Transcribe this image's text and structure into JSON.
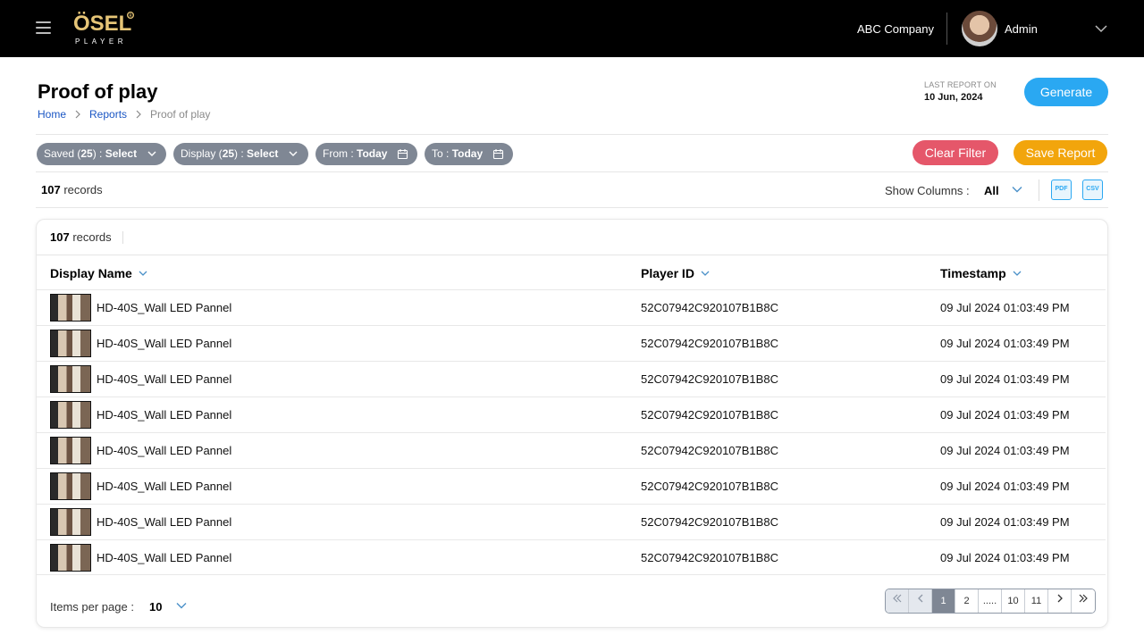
{
  "header": {
    "logo_main": "ÖSEL",
    "logo_sub": "PLAYER",
    "logo_reg": "®",
    "company": "ABC Company",
    "user": "Admin"
  },
  "page": {
    "title": "Proof of play",
    "breadcrumb": [
      "Home",
      "Reports",
      "Proof of play"
    ],
    "last_report_label": "LAST REPORT ON",
    "last_report_date": "10 Jun, 2024",
    "generate_label": "Generate"
  },
  "filters": {
    "saved_prefix": "Saved (",
    "saved_count": "25",
    "saved_suffix": ") : ",
    "saved_value": "Select",
    "display_prefix": "Display (",
    "display_count": "25",
    "display_suffix": ") : ",
    "display_value": "Select",
    "from_label": "From : ",
    "from_value": "Today",
    "to_label": "To : ",
    "to_value": "Today",
    "clear_label": "Clear Filter",
    "save_label": "Save Report"
  },
  "toolbar": {
    "records_count": "107",
    "records_label": " records",
    "show_columns_label": "Show Columns :",
    "show_columns_value": "All",
    "pdf_label": "PDF",
    "csv_label": "CSV"
  },
  "table": {
    "records_count": "107",
    "records_label": " records",
    "columns": [
      "Display Name",
      "Player ID",
      "Timestamp"
    ],
    "rows": [
      {
        "name": "HD-40S_Wall LED Pannel",
        "player_id": "52C07942C920107B1B8C",
        "timestamp": "09 Jul 2024 01:03:49 PM"
      },
      {
        "name": "HD-40S_Wall LED Pannel",
        "player_id": "52C07942C920107B1B8C",
        "timestamp": "09 Jul 2024 01:03:49 PM"
      },
      {
        "name": "HD-40S_Wall LED Pannel",
        "player_id": "52C07942C920107B1B8C",
        "timestamp": "09 Jul 2024 01:03:49 PM"
      },
      {
        "name": "HD-40S_Wall LED Pannel",
        "player_id": "52C07942C920107B1B8C",
        "timestamp": "09 Jul 2024 01:03:49 PM"
      },
      {
        "name": "HD-40S_Wall LED Pannel",
        "player_id": "52C07942C920107B1B8C",
        "timestamp": "09 Jul 2024 01:03:49 PM"
      },
      {
        "name": "HD-40S_Wall LED Pannel",
        "player_id": "52C07942C920107B1B8C",
        "timestamp": "09 Jul 2024 01:03:49 PM"
      },
      {
        "name": "HD-40S_Wall LED Pannel",
        "player_id": "52C07942C920107B1B8C",
        "timestamp": "09 Jul 2024 01:03:49 PM"
      },
      {
        "name": "HD-40S_Wall LED Pannel",
        "player_id": "52C07942C920107B1B8C",
        "timestamp": "09 Jul 2024 01:03:49 PM"
      }
    ]
  },
  "footer": {
    "items_per_page_label": "Items per page :",
    "items_per_page_value": "10",
    "pages": [
      "1",
      "2",
      ".....",
      "10",
      "11"
    ],
    "active_page": "1"
  },
  "colors": {
    "primary": "#2aa8f2",
    "danger": "#e5576a",
    "warning": "#f2a50c",
    "chip": "#7f8794",
    "logo_gold": "#e6c577"
  },
  "icons": [
    "menu-icon",
    "chevron-down-icon",
    "calendar-icon",
    "chevron-right-icon",
    "first-page-icon",
    "prev-page-icon",
    "next-page-icon",
    "last-page-icon"
  ]
}
